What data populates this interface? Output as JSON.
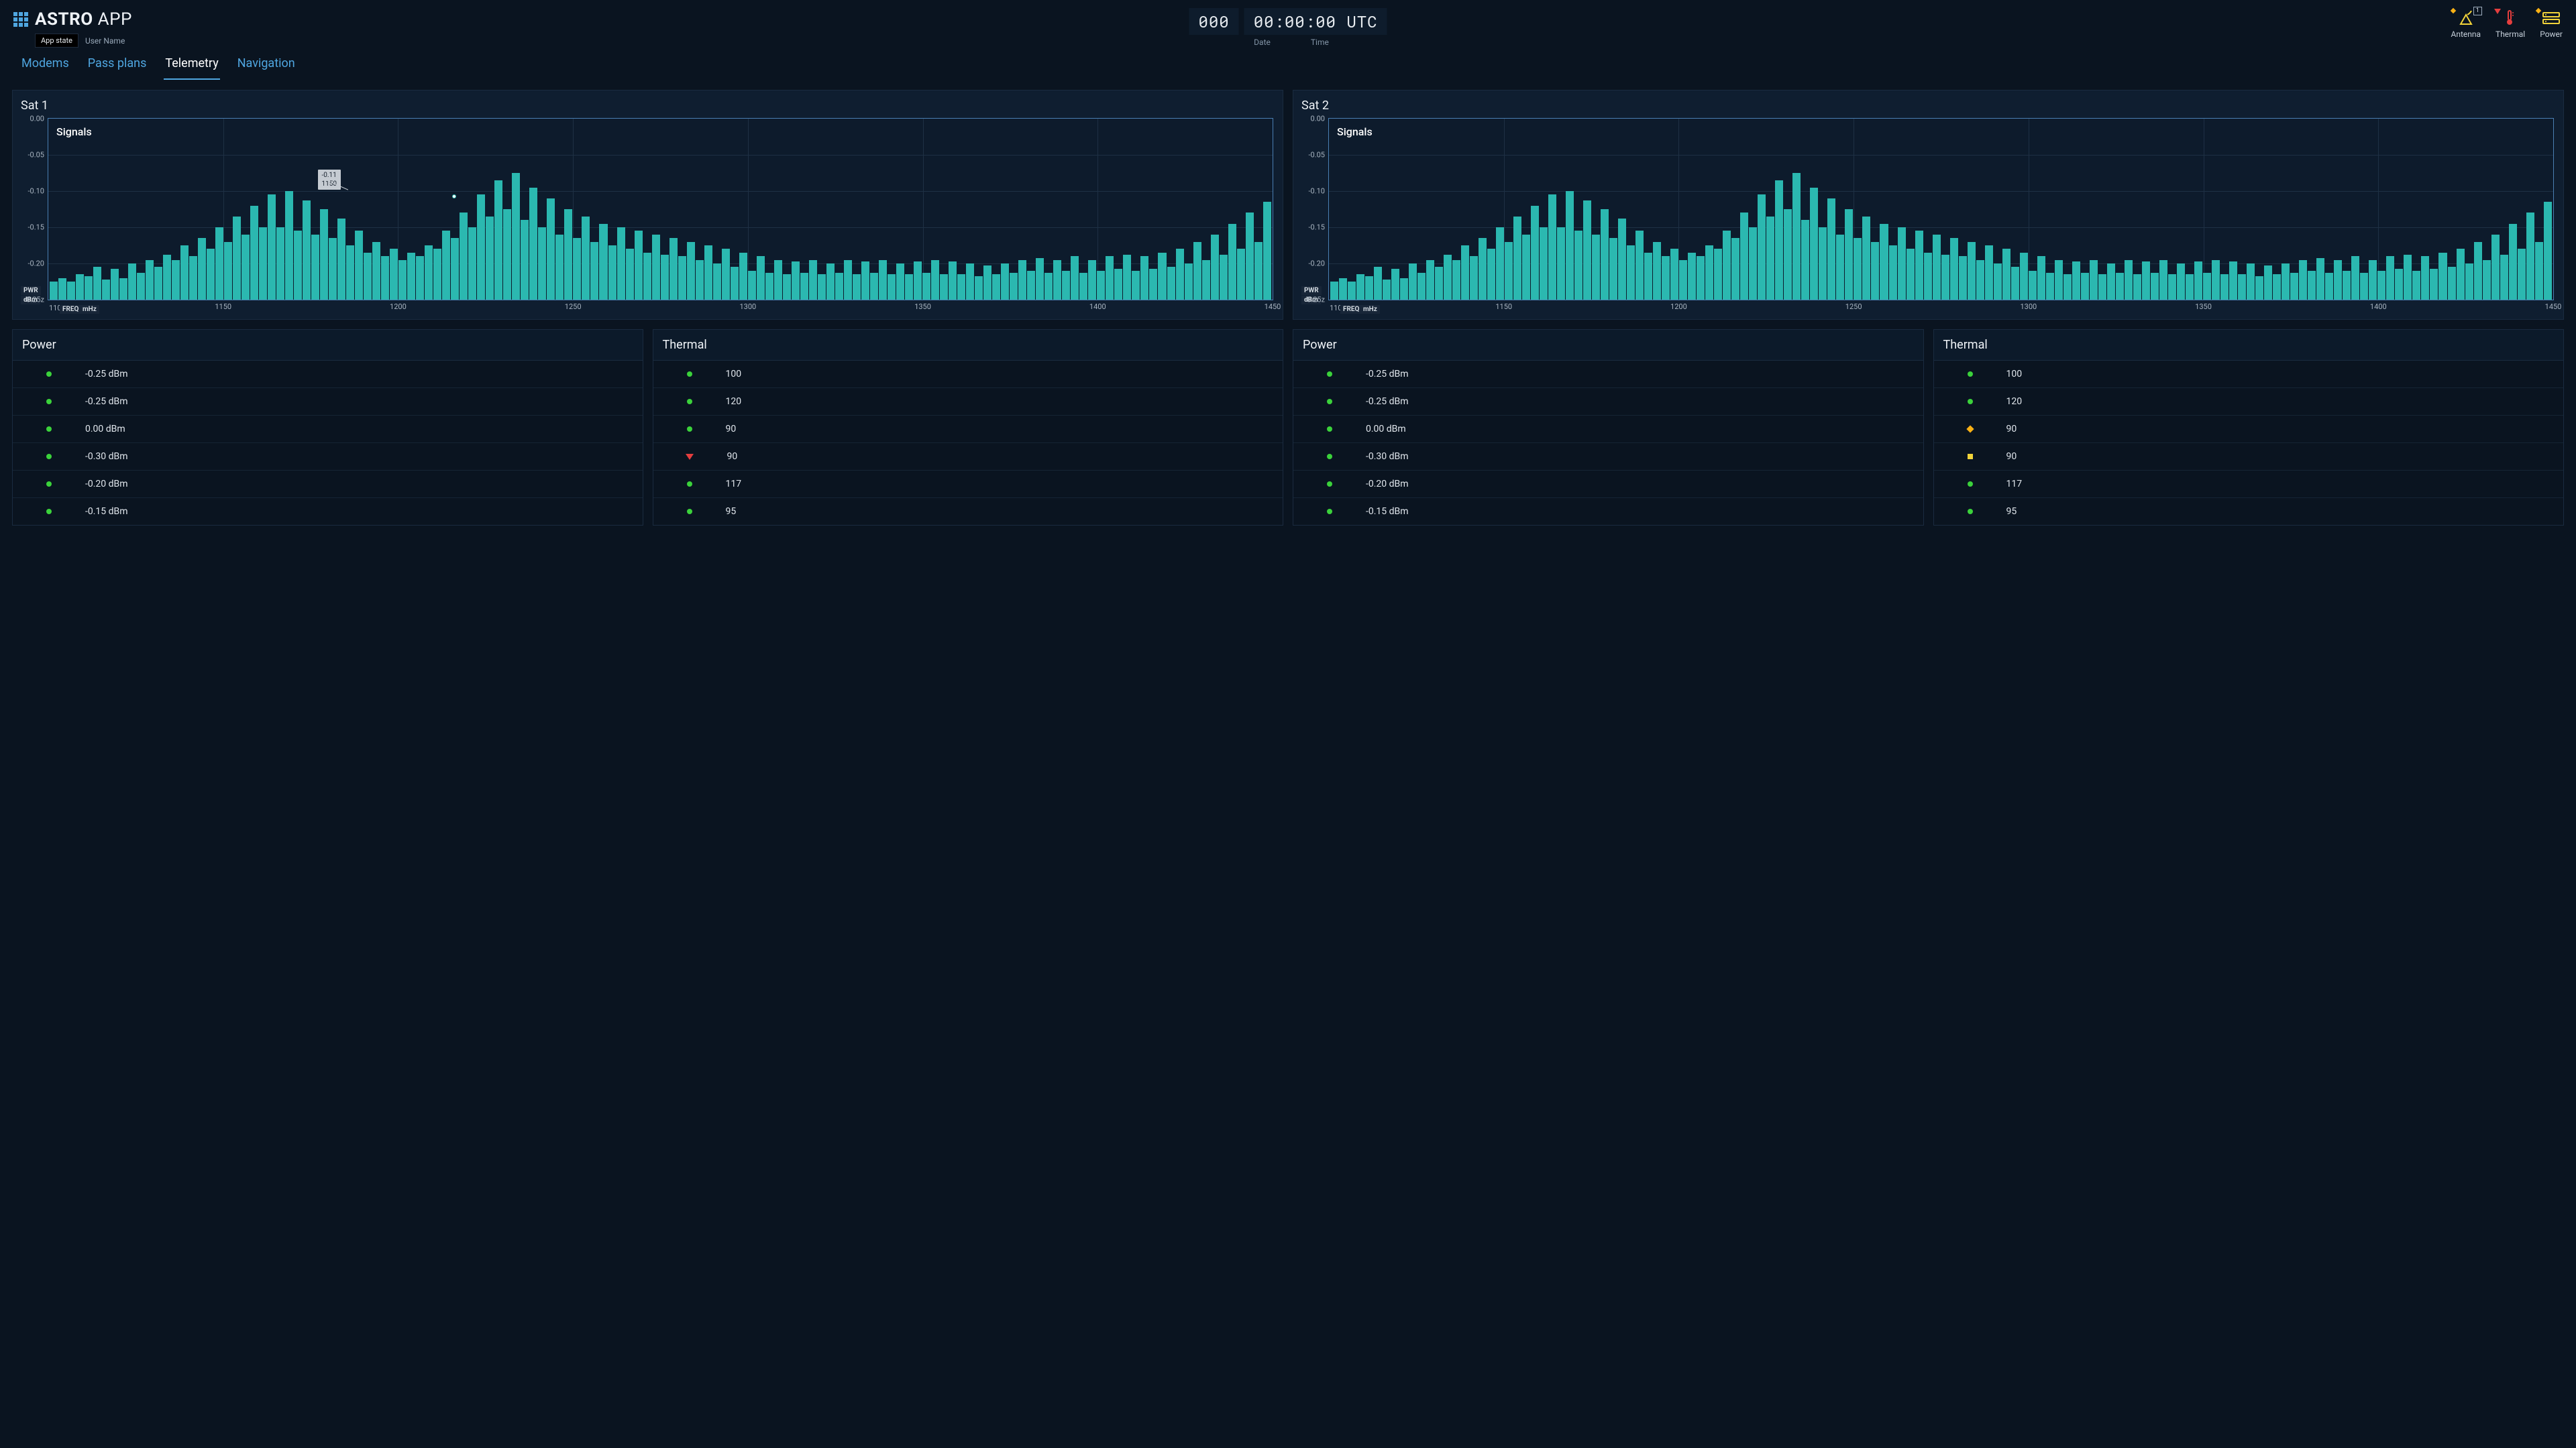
{
  "header": {
    "brand_bold": "ASTRO",
    "brand_light": "APP",
    "app_state_label": "App state",
    "user_name": "User Name",
    "date_value": "000",
    "time_value": "00:00:00 UTC",
    "date_label": "Date",
    "time_label": "Time",
    "status": {
      "antenna": {
        "label": "Antenna",
        "marker": "diamond",
        "badge": "1"
      },
      "thermal": {
        "label": "Thermal",
        "marker": "triangle"
      },
      "power": {
        "label": "Power",
        "marker": "diamond"
      }
    }
  },
  "tabs": [
    "Modems",
    "Pass plans",
    "Telemetry",
    "Navigation"
  ],
  "active_tab": "Telemetry",
  "sats": [
    {
      "name": "Sat 1",
      "chart_title": "Signals",
      "tooltip": {
        "v1": "-0.11",
        "v2": "1150"
      },
      "power_title": "Power",
      "thermal_title": "Thermal",
      "power": [
        {
          "status": "ok",
          "value": "-0.25 dBm"
        },
        {
          "status": "ok",
          "value": "-0.25 dBm"
        },
        {
          "status": "ok",
          "value": "0.00 dBm"
        },
        {
          "status": "ok",
          "value": "-0.30 dBm"
        },
        {
          "status": "ok",
          "value": "-0.20 dBm"
        },
        {
          "status": "ok",
          "value": "-0.15 dBm"
        }
      ],
      "thermal": [
        {
          "status": "ok",
          "value": "100"
        },
        {
          "status": "ok",
          "value": "120"
        },
        {
          "status": "ok",
          "value": "90"
        },
        {
          "status": "crit",
          "value": "90"
        },
        {
          "status": "ok",
          "value": "117"
        },
        {
          "status": "ok",
          "value": "95"
        }
      ]
    },
    {
      "name": "Sat 2",
      "chart_title": "Signals",
      "power_title": "Power",
      "thermal_title": "Thermal",
      "power": [
        {
          "status": "ok",
          "value": "-0.25 dBm"
        },
        {
          "status": "ok",
          "value": "-0.25 dBm"
        },
        {
          "status": "ok",
          "value": "0.00 dBm"
        },
        {
          "status": "ok",
          "value": "-0.30 dBm"
        },
        {
          "status": "ok",
          "value": "-0.20 dBm"
        },
        {
          "status": "ok",
          "value": "-0.15 dBm"
        }
      ],
      "thermal": [
        {
          "status": "ok",
          "value": "100"
        },
        {
          "status": "ok",
          "value": "120"
        },
        {
          "status": "warn-diamond",
          "value": "90"
        },
        {
          "status": "warn-square",
          "value": "90"
        },
        {
          "status": "ok",
          "value": "117"
        },
        {
          "status": "ok",
          "value": "95"
        }
      ]
    }
  ],
  "chart_axes": {
    "y_ticks": [
      "0.00",
      "-0.05",
      "-0.10",
      "-0.15",
      "-0.20",
      "-0.25z"
    ],
    "y_label_1": "PWR",
    "y_label_2": "dBm",
    "x_min": "1100",
    "x_label_1": "FREQ",
    "x_label_2": "mHz",
    "x_ticks": [
      "1150",
      "1200",
      "1250",
      "1300",
      "1350",
      "1400",
      "1450"
    ]
  },
  "chart_data": {
    "type": "bar",
    "title": "Signals",
    "xlabel": "FREQ mHz",
    "ylabel": "PWR dBm",
    "xlim": [
      1100,
      1450
    ],
    "ylim": [
      -0.25,
      0.0
    ],
    "note": "~140 narrow bars; heights are magnitude of negative dBm values where 0 = 0 dBm and 1 = -0.25 dBm. Same profile used for Sat 1 and Sat 2. A callout on Sat 1 marks the point (-0.11 dBm at 1150).",
    "heights": [
      0.1,
      0.12,
      0.1,
      0.14,
      0.13,
      0.18,
      0.11,
      0.17,
      0.12,
      0.2,
      0.15,
      0.22,
      0.18,
      0.25,
      0.22,
      0.3,
      0.24,
      0.34,
      0.28,
      0.4,
      0.32,
      0.46,
      0.36,
      0.52,
      0.4,
      0.58,
      0.4,
      0.6,
      0.38,
      0.55,
      0.36,
      0.5,
      0.34,
      0.45,
      0.3,
      0.38,
      0.26,
      0.32,
      0.24,
      0.28,
      0.22,
      0.26,
      0.24,
      0.3,
      0.28,
      0.38,
      0.34,
      0.48,
      0.4,
      0.58,
      0.46,
      0.66,
      0.5,
      0.7,
      0.44,
      0.62,
      0.4,
      0.56,
      0.36,
      0.5,
      0.34,
      0.46,
      0.32,
      0.42,
      0.3,
      0.4,
      0.28,
      0.38,
      0.26,
      0.36,
      0.25,
      0.34,
      0.24,
      0.32,
      0.22,
      0.3,
      0.2,
      0.28,
      0.18,
      0.26,
      0.16,
      0.24,
      0.15,
      0.22,
      0.14,
      0.21,
      0.15,
      0.22,
      0.14,
      0.2,
      0.15,
      0.22,
      0.14,
      0.21,
      0.15,
      0.22,
      0.14,
      0.2,
      0.14,
      0.21,
      0.15,
      0.22,
      0.14,
      0.21,
      0.14,
      0.2,
      0.13,
      0.19,
      0.14,
      0.2,
      0.15,
      0.22,
      0.16,
      0.23,
      0.15,
      0.22,
      0.16,
      0.24,
      0.15,
      0.22,
      0.16,
      0.24,
      0.17,
      0.25,
      0.16,
      0.24,
      0.17,
      0.26,
      0.18,
      0.28,
      0.2,
      0.32,
      0.22,
      0.36,
      0.25,
      0.42,
      0.28,
      0.48,
      0.32,
      0.54
    ]
  }
}
